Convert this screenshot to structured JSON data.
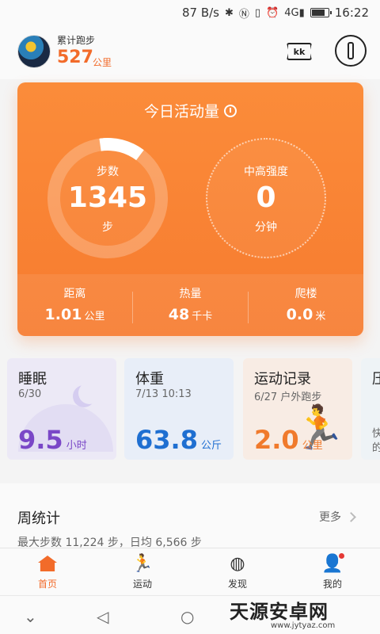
{
  "status_bar": {
    "network_speed": "87 B/s",
    "signal_text": "4G",
    "time": "16:22"
  },
  "header": {
    "accumulated_label": "累计跑步",
    "accumulated_value": "527",
    "accumulated_unit": "公里",
    "kk_label": "kk"
  },
  "activity": {
    "title": "今日活动量",
    "steps_label": "步数",
    "steps_value": "1345",
    "steps_unit": "步",
    "intensity_label": "中高强度",
    "intensity_value": "0",
    "intensity_unit": "分钟",
    "distance_label": "距离",
    "distance_value": "1.01",
    "distance_unit": "公里",
    "calories_label": "热量",
    "calories_value": "48",
    "calories_unit": "千卡",
    "floors_label": "爬楼",
    "floors_value": "0.0",
    "floors_unit": "米"
  },
  "tiles": {
    "sleep": {
      "title": "睡眠",
      "subtitle": "6/30",
      "value": "9.5",
      "unit": "小时"
    },
    "weight": {
      "title": "体重",
      "subtitle": "7/13 10:13",
      "value": "63.8",
      "unit": "公斤"
    },
    "run": {
      "title": "运动记录",
      "subtitle": "6/27 户外跑步",
      "value": "2.0",
      "unit": "公里"
    },
    "extra": {
      "title": "压",
      "line1": "快",
      "line2": "的"
    }
  },
  "weekly": {
    "title": "周统计",
    "more": "更多",
    "summary": "最大步数 11,224 步，日均 6,566 步"
  },
  "nav": {
    "home": "首页",
    "sport": "运动",
    "discover": "发现",
    "mine": "我的"
  },
  "watermark": {
    "main": "天源安卓网",
    "url": "www.jytyaz.com"
  },
  "colors": {
    "accent": "#f26b2a",
    "sleep": "#7a47c7",
    "weight": "#1f6fd1",
    "run": "#f07a2c"
  }
}
